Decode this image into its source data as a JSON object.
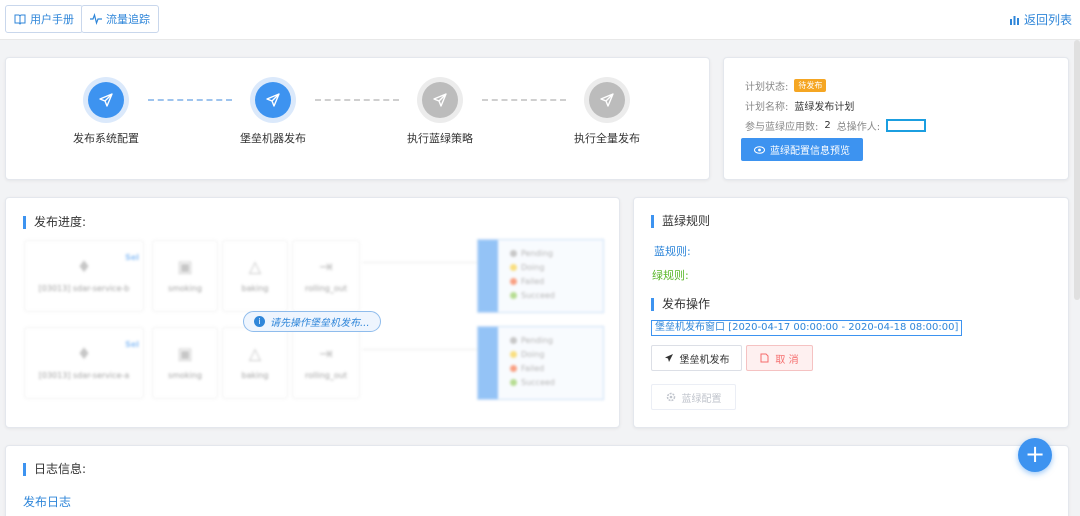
{
  "topbar": {
    "manual_label": "用户手册",
    "trace_label": "流量追踪",
    "back_label": "返回列表"
  },
  "steps": [
    {
      "label": "发布系统配置",
      "state": "active"
    },
    {
      "label": "堡垒机器发布",
      "state": "active"
    },
    {
      "label": "执行蓝绿策略",
      "state": "inactive"
    },
    {
      "label": "执行全量发布",
      "state": "inactive"
    }
  ],
  "plan": {
    "status_label": "计划状态:",
    "status_value": "待发布",
    "name_label": "计划名称:",
    "name_value": "蓝绿发布计划",
    "apps_label": "参与蓝绿应用数:",
    "apps_value": "2",
    "operator_label": "总操作人:",
    "preview_button": "蓝绿配置信息预览"
  },
  "progress": {
    "title": "发布进度:",
    "tip": "请先操作堡垒机发布...",
    "rows": [
      {
        "service": "[03013] sdar-service-b",
        "tag": "Sel"
      },
      {
        "service": "[03013] sdar-service-a",
        "tag": "Sel"
      }
    ],
    "stages": [
      "smoking",
      "baking",
      "rolling_out"
    ],
    "legend": [
      "Pending",
      "Doing",
      "Failed",
      "Succeed"
    ]
  },
  "rules": {
    "title": "蓝绿规则",
    "blue_rule": "蓝规则:",
    "green_rule": "绿规则:"
  },
  "ops": {
    "title": "发布操作",
    "window": "堡垒机发布窗口 [2020-04-17 00:00:00 - 2020-04-18 08:00:00]",
    "fort_button": "堡垒机发布",
    "cancel_button": "取 消",
    "bg_button": "蓝绿配置"
  },
  "log": {
    "title": "日志信息:",
    "sub": "发布日志"
  },
  "colors": {
    "accent": "#3d93f0",
    "pending": "#f5a623",
    "green": "#5cb82c",
    "danger": "#f56c6c"
  }
}
